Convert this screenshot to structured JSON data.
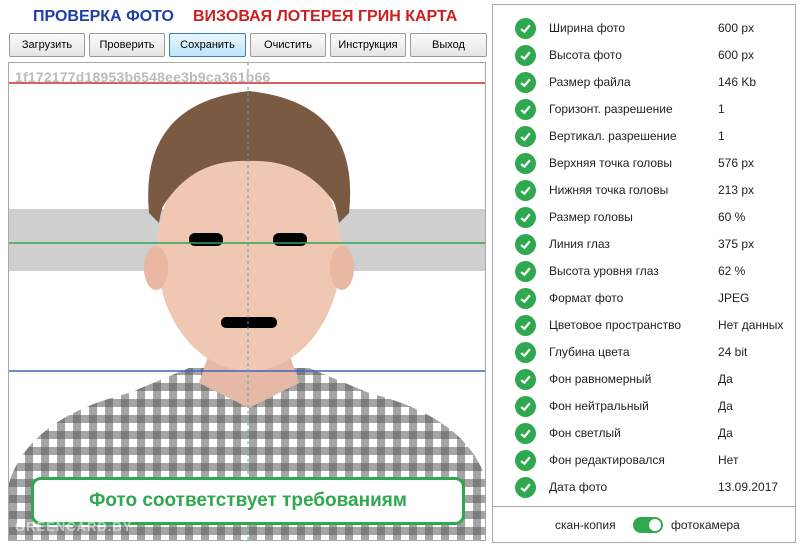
{
  "header": {
    "title_check": "ПРОВЕРКА ФОТО",
    "title_lottery": "ВИЗОВАЯ ЛОТЕРЕЯ ГРИН КАРТА"
  },
  "toolbar": {
    "load_label": "Загрузить",
    "check_label": "Проверить",
    "save_label": "Сохранить",
    "clear_label": "Очистить",
    "instruction_label": "Инструкция",
    "exit_label": "Выход"
  },
  "photo": {
    "hash": "1f172177d18953b6548ee3b9ca361b66",
    "status_text": "Фото соответствует требованиям",
    "watermark": "GREENCARD.BY"
  },
  "results": [
    {
      "label": "Ширина фото",
      "value": "600 px"
    },
    {
      "label": "Высота фото",
      "value": "600 px"
    },
    {
      "label": "Размер файла",
      "value": "146 Kb"
    },
    {
      "label": "Горизонт. разрешение",
      "value": "1"
    },
    {
      "label": "Вертикал. разрешение",
      "value": "1"
    },
    {
      "label": "Верхняя точка головы",
      "value": "576 px"
    },
    {
      "label": "Нижняя точка головы",
      "value": "213 px"
    },
    {
      "label": "Размер головы",
      "value": "60 %"
    },
    {
      "label": "Линия глаз",
      "value": "375 px"
    },
    {
      "label": "Высота уровня глаз",
      "value": "62 %"
    },
    {
      "label": "Формат фото",
      "value": "JPEG"
    },
    {
      "label": "Цветовое пространство",
      "value": "Нет данных"
    },
    {
      "label": "Глубина цвета",
      "value": "24 bit"
    },
    {
      "label": "Фон равномерный",
      "value": "Да"
    },
    {
      "label": "Фон нейтральный",
      "value": "Да"
    },
    {
      "label": "Фон светлый",
      "value": "Да"
    },
    {
      "label": "Фон редактировался",
      "value": "Нет"
    },
    {
      "label": "Дата фото",
      "value": "13.09.2017"
    }
  ],
  "mode": {
    "left_label": "скан-копия",
    "right_label": "фотокамера",
    "camera_selected": true
  },
  "colors": {
    "accent_green": "#2fa84f",
    "title_blue": "#1f3fa6",
    "title_red": "#cc1f1f"
  }
}
